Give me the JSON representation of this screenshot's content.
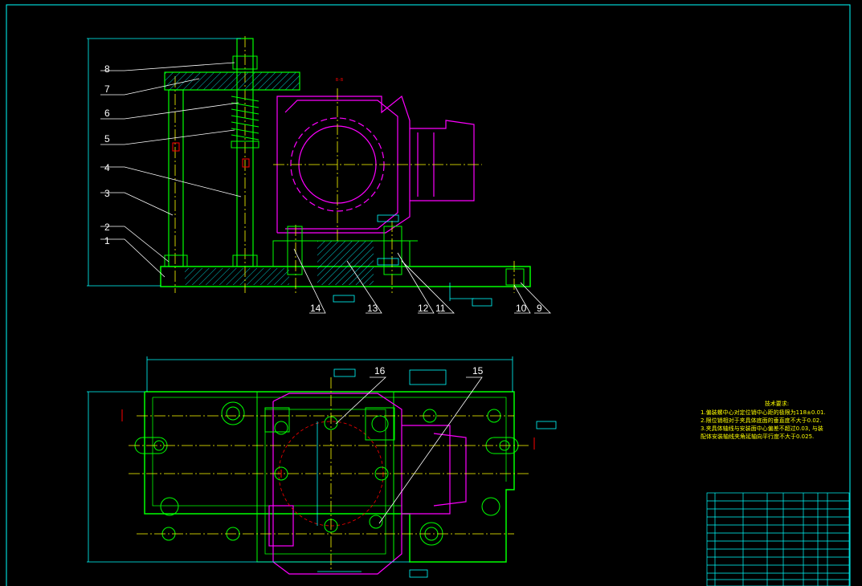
{
  "colors": {
    "background": "#000000",
    "frame": "#00ffff",
    "outline": "#00ff00",
    "hidden_part": "#ff00ff",
    "centerline": "#ffff00",
    "leader": "#ffffff",
    "section": "#00ffff",
    "dimension": "#00ffff",
    "mark": "#ff0000",
    "notes": "#ffff00"
  },
  "part_labels": [
    "1",
    "2",
    "3",
    "4",
    "5",
    "6",
    "7",
    "8",
    "9",
    "10",
    "11",
    "12",
    "13",
    "14",
    "15",
    "16"
  ],
  "technical_requirements": {
    "title": "技术要求:",
    "lines": [
      "1.偏装螺中心对定位销中心距的极限为118±0.01.",
      "2.限位销相对于夹具体底面的垂直度不大于0.02.",
      "3.夹具体轴线与安装面中心偏差不超过0.03, 与装",
      "  配体安装轴线夹角延轴向平行度不大于0.025."
    ]
  }
}
